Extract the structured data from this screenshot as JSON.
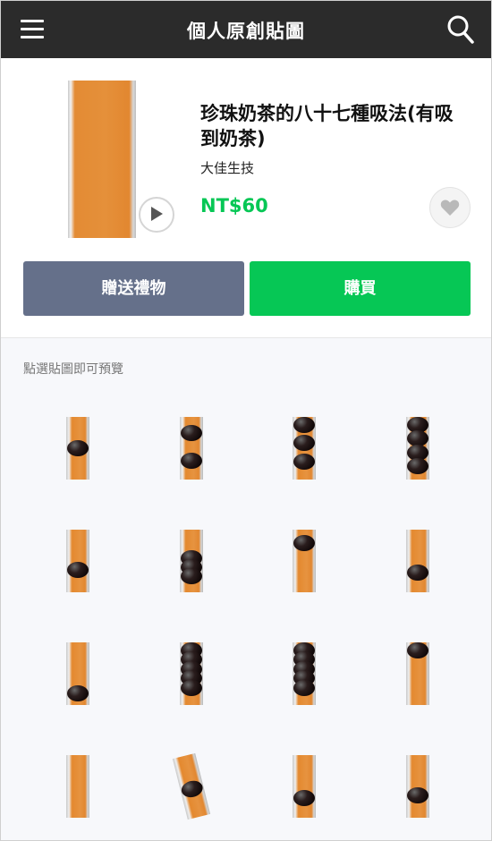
{
  "header": {
    "title": "個人原創貼圖",
    "menu_icon": "menu-icon",
    "search_icon": "search-icon"
  },
  "product": {
    "title": "珍珠奶茶的八十七種吸法(有吸到奶茶)",
    "author": "大佳生技",
    "price": "NT$60",
    "gift_label": "贈送禮物",
    "buy_label": "購買",
    "play_icon": "play-icon",
    "favorite_icon": "heart-icon"
  },
  "grid": {
    "hint": "點選貼圖即可預覽",
    "stickers": [
      {
        "pearls": [
          0.5
        ]
      },
      {
        "pearls": [
          0.18,
          0.76
        ]
      },
      {
        "pearls": [
          0.0,
          0.39,
          0.78
        ]
      },
      {
        "pearls": [
          0.0,
          0.29,
          0.59,
          0.88
        ]
      },
      {
        "pearls": [
          0.7
        ]
      },
      {
        "pearls": [
          0.45,
          0.63,
          0.82
        ]
      },
      {
        "pearls": [
          0.12
        ]
      },
      {
        "pearls": [
          0.75
        ]
      },
      {
        "pearls": [
          0.93
        ]
      },
      {
        "pearls": [
          0.0,
          0.2,
          0.4,
          0.6,
          0.8
        ]
      },
      {
        "pearls": [
          0.0,
          0.2,
          0.4,
          0.6,
          0.8
        ]
      },
      {
        "pearls": [
          0.0
        ]
      },
      {
        "pearls": []
      },
      {
        "pearls": [
          0.55
        ],
        "tilted": true
      },
      {
        "pearls": [
          0.75
        ]
      },
      {
        "pearls": [
          0.7
        ]
      }
    ]
  },
  "colors": {
    "green": "#06c755",
    "gift": "#65708a",
    "header": "#2b2b2b",
    "straw": "#e5903a"
  }
}
